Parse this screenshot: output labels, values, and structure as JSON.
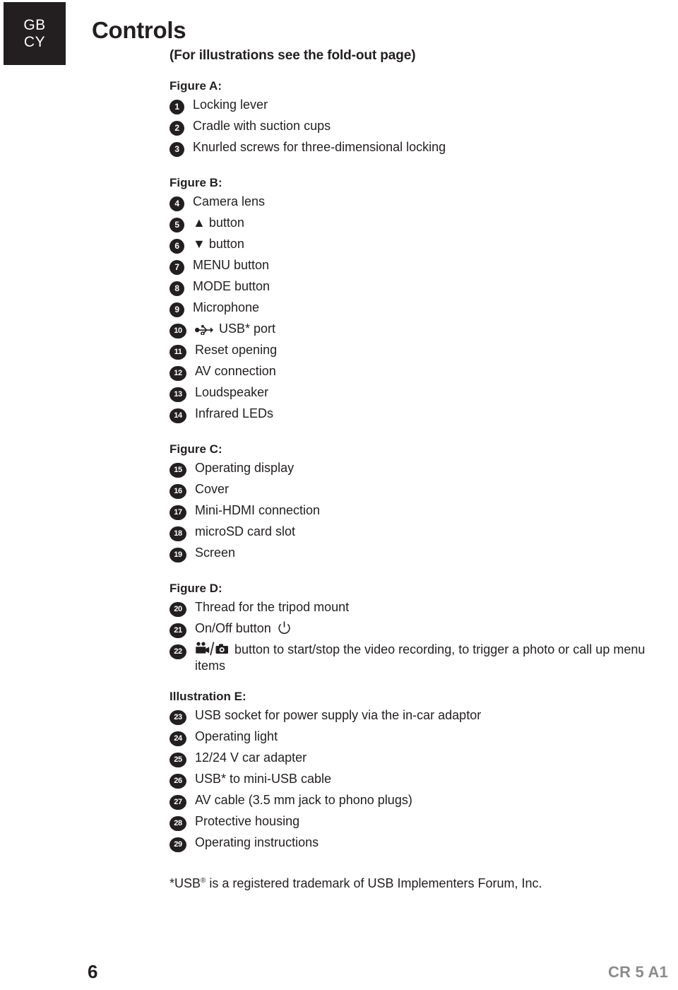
{
  "badge": {
    "line1": "GB",
    "line2": "CY"
  },
  "title": "Controls",
  "subtitle": "(For illustrations see the fold-out page)",
  "colors": {
    "ink": "#231f20",
    "badge_background": "#231f20",
    "badge_text": "#ffffff",
    "model_gray": "#8c8c8c",
    "page_background": "#ffffff"
  },
  "sections": [
    {
      "heading": "Figure A:",
      "items": [
        {
          "num": "1",
          "text": "Locking lever"
        },
        {
          "num": "2",
          "text": "Cradle with suction cups"
        },
        {
          "num": "3",
          "text": "Knurled screws for three-dimensional locking"
        }
      ]
    },
    {
      "heading": "Figure B:",
      "items": [
        {
          "num": "4",
          "text": "Camera lens"
        },
        {
          "num": "5",
          "text": "▲ button",
          "icon": "up-triangle-icon"
        },
        {
          "num": "6",
          "text": "▼ button",
          "icon": "down-triangle-icon"
        },
        {
          "num": "7",
          "text": "MENU button"
        },
        {
          "num": "8",
          "text": "MODE button"
        },
        {
          "num": "9",
          "text": "Microphone"
        },
        {
          "num": "10",
          "text": "USB* port",
          "icon": "usb-icon"
        },
        {
          "num": "11",
          "text": "Reset opening"
        },
        {
          "num": "12",
          "text": "AV connection"
        },
        {
          "num": "13",
          "text": "Loudspeaker"
        },
        {
          "num": "14",
          "text": "Infrared LEDs"
        }
      ]
    },
    {
      "heading": "Figure C:",
      "items": [
        {
          "num": "15",
          "text": "Operating display"
        },
        {
          "num": "16",
          "text": "Cover"
        },
        {
          "num": "17",
          "text": "Mini-HDMI connection"
        },
        {
          "num": "18",
          "text": "microSD card slot"
        },
        {
          "num": "19",
          "text": "Screen"
        }
      ]
    },
    {
      "heading": "Figure D:",
      "items": [
        {
          "num": "20",
          "text": "Thread for the tripod mount"
        },
        {
          "num": "21",
          "text": "On/Off button",
          "icon": "power-icon"
        },
        {
          "num": "22",
          "text": "button to start/stop the video recording, to trigger a photo or call up menu items",
          "icon": "video-photo-icon"
        }
      ]
    },
    {
      "heading": "Illustration E:",
      "items": [
        {
          "num": "23",
          "text": "USB socket for power supply via the in-car adaptor"
        },
        {
          "num": "24",
          "text": "Operating light"
        },
        {
          "num": "25",
          "text": "12/24 V car adapter"
        },
        {
          "num": "26",
          "text": "USB* to mini-USB cable"
        },
        {
          "num": "27",
          "text": "AV cable (3.5 mm jack to phono plugs)"
        },
        {
          "num": "28",
          "text": "Protective housing"
        },
        {
          "num": "29",
          "text": "Operating instructions"
        }
      ]
    }
  ],
  "footnote": {
    "prefix": "*USB",
    "mark": "®",
    "suffix": " is a registered trademark of USB Implementers Forum, Inc."
  },
  "footer": {
    "page_number": "6",
    "model": "CR 5 A1"
  }
}
